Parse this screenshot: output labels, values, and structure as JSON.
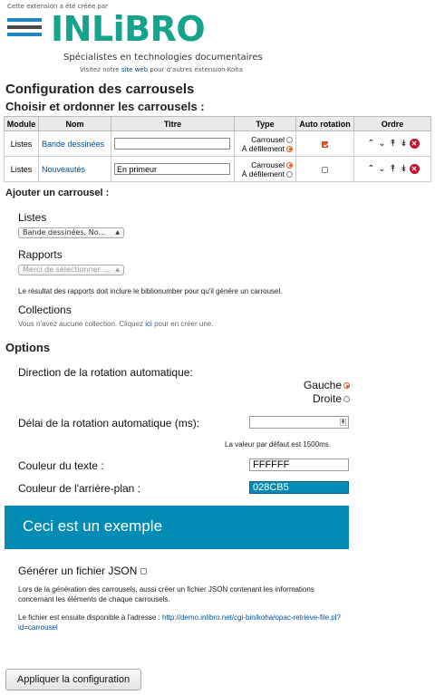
{
  "header": {
    "credit": "Cette extension a été créée par",
    "logo_text": "INLiBRO",
    "tagline": "Spécialistes en technologies documentaires",
    "visit_prefix": "Visitez notre ",
    "visit_link": "site web",
    "visit_suffix": " pour d'autres extension Koha"
  },
  "page_title": "Configuration des carrousels",
  "order_title": "Choisir et ordonner les carrousels :",
  "table": {
    "headers": [
      "Module",
      "Nom",
      "Titre",
      "Type",
      "Auto rotation",
      "Ordre"
    ],
    "type_carrousel": "Carrousel",
    "type_defilement": "À défilement",
    "rows": [
      {
        "module": "Listes",
        "name": "Bande dessinées",
        "title": "",
        "type": "defilement",
        "auto_rotation": true
      },
      {
        "module": "Listes",
        "name": "Nouveautés",
        "title": "En primeur",
        "type": "carrousel",
        "auto_rotation": false
      }
    ],
    "order_icons": [
      "chevron-up-icon",
      "chevron-down-icon",
      "double-chevron-up-icon",
      "double-chevron-down-icon",
      "delete-icon"
    ]
  },
  "add": {
    "title": "Ajouter un carrousel :",
    "lists_label": "Listes",
    "lists_select": "Bande dessinées, No...",
    "reports_label": "Rapports",
    "reports_select": "Merci de sélectionner ...",
    "reports_note": "Le résultat des rapports doit inclure le biblionumber pour qu'il génère un carrousel.",
    "collections_label": "Collections",
    "collections_prefix": "Vous n'avez aucune collection. Cliquez ",
    "collections_link": "ici",
    "collections_suffix": " pour en créer une."
  },
  "options": {
    "title": "Options",
    "direction_label": "Direction de la rotation automatique:",
    "direction_left": "Gauche",
    "direction_right": "Droite",
    "direction_selected": "Gauche",
    "delay_label": "Délai de la rotation automatique (ms):",
    "delay_value": "",
    "delay_note": "La valeur par défaut est 1500ms.",
    "text_color_label": "Couleur du texte :",
    "text_color_value": "FFFFFF",
    "bg_color_label": "Couleur de l'arrière-plan :",
    "bg_color_value": "028CB5",
    "example_text": "Ceci est un exemple",
    "json_label": "Générer un fichier JSON",
    "json_checked": false,
    "json_note": "Lors de la génération des carrousels, aussi créer un fichier JSON contenant les informations concernant les éléments de chaque carrousels.",
    "json_url_prefix": "Le fichier est ensuite disponible à l'adresse : ",
    "json_url": "http://demo.inlibro.net/cgi-bin/koha/opac-retrieve-file.pl?id=carrousel"
  },
  "apply_button": "Appliquer la configuration",
  "colors": {
    "accent": "#028CB5",
    "logo_green": "#14A38B",
    "radio_on": "#E0541B",
    "delete": "#C8102E"
  }
}
